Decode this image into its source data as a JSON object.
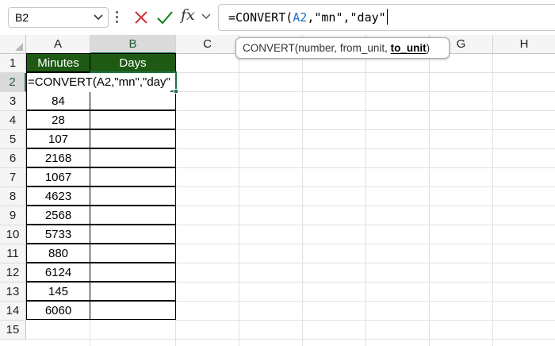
{
  "formula_bar": {
    "name_box": "B2",
    "fx_label": "fx",
    "formula_prefix": "=CONVERT(",
    "formula_ref": "A2",
    "formula_suffix": ",\"mn\",\"day\""
  },
  "tooltip": {
    "function_name": "CONVERT(",
    "arg1": "number",
    "sep1": ", ",
    "arg2": "from_unit",
    "sep2": ", ",
    "arg3": "to_unit",
    "close": ")"
  },
  "columns": [
    "A",
    "B",
    "C",
    "D",
    "E",
    "F",
    "G",
    "H"
  ],
  "rows": [
    "1",
    "2",
    "3",
    "4",
    "5",
    "6",
    "7",
    "8",
    "9",
    "10",
    "11",
    "12",
    "13",
    "14",
    "15"
  ],
  "table": {
    "header_minutes": "Minutes",
    "header_days": "Days",
    "editing_text": "=CONVERT(A2,\"mn\",\"day\"",
    "minutes": [
      "84",
      "28",
      "107",
      "2168",
      "1067",
      "4623",
      "2568",
      "5733",
      "880",
      "6124",
      "145",
      "6060"
    ]
  },
  "colors": {
    "header_fill": "#1e5a14",
    "selection": "#1e7145",
    "cell_ref": "#1a6fc9",
    "cancel": "#d13438",
    "confirm": "#107c10"
  },
  "icons": [
    "chevron-down-icon",
    "more-dots-icon",
    "cancel-icon",
    "confirm-icon",
    "fx-icon"
  ]
}
